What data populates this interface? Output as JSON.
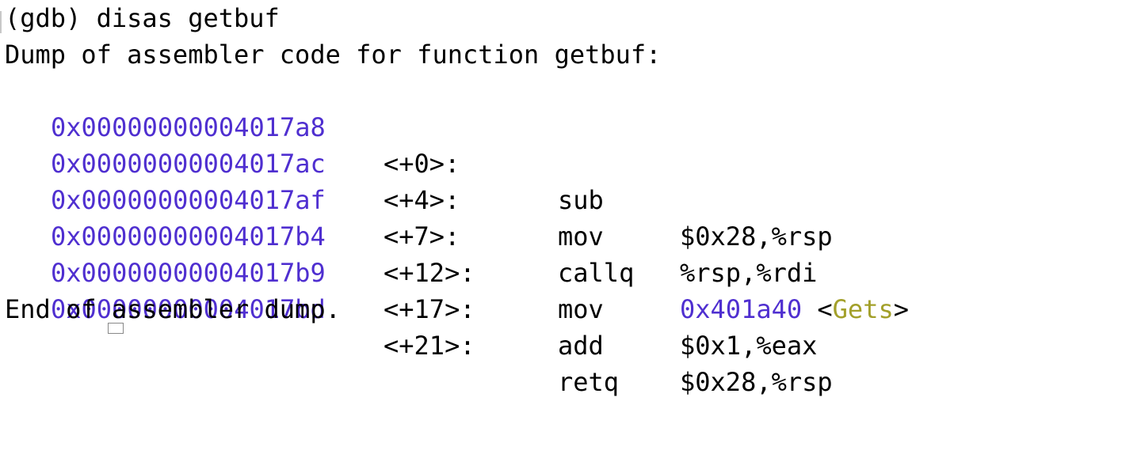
{
  "terminal": {
    "prompt_line": "(gdb) disas getbuf",
    "header_line": "Dump of assembler code for function getbuf:",
    "footer_line": "End of assembler dump.",
    "instructions": [
      {
        "address": "0x00000000004017a8",
        "offset": "<+0>:",
        "mnemonic": "sub",
        "operands": "$0x28,%rsp"
      },
      {
        "address": "0x00000000004017ac",
        "offset": "<+4>:",
        "mnemonic": "mov",
        "operands": "%rsp,%rdi"
      },
      {
        "address": "0x00000000004017af",
        "offset": "<+7>:",
        "mnemonic": "callq",
        "target_address": "0x401a40",
        "target_open": "<",
        "target_symbol": "Gets",
        "target_close": ">"
      },
      {
        "address": "0x00000000004017b4",
        "offset": "<+12>:",
        "mnemonic": "mov",
        "operands": "$0x1,%eax"
      },
      {
        "address": "0x00000000004017b9",
        "offset": "<+17>:",
        "mnemonic": "add",
        "operands": "$0x28,%rsp"
      },
      {
        "address": "0x00000000004017bd",
        "offset": "<+21>:",
        "mnemonic": "retq",
        "operands": ""
      }
    ]
  },
  "colors": {
    "background": "#ffffff",
    "text": "#000000",
    "address": "#4f2fd0",
    "symbol": "#a3a02a"
  }
}
